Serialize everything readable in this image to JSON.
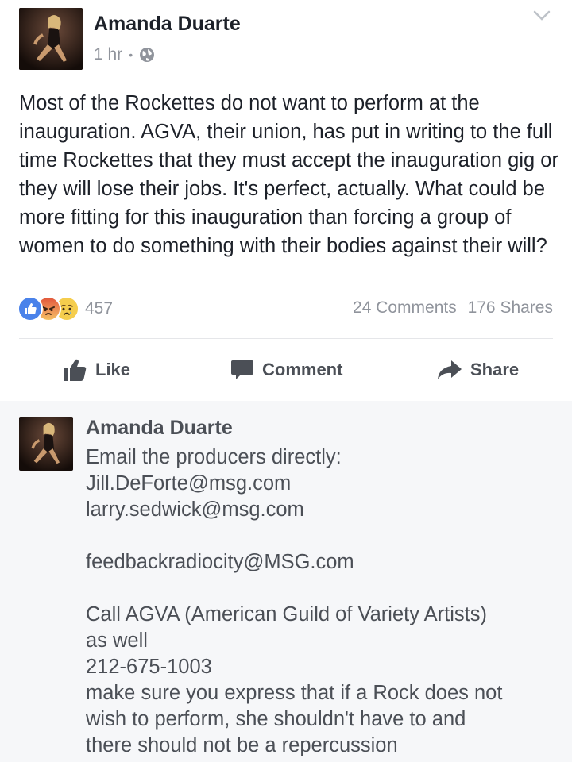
{
  "post": {
    "author": "Amanda Duarte",
    "time": "1 hr",
    "separator": "•",
    "privacy_icon": "globe-icon",
    "text": "Most of the Rockettes do not want to perform at the inauguration. AGVA, their union, has put in writing to the full time Rockettes that they must accept the inauguration gig or they will lose their jobs. It's perfect, actually. What could be more fitting for this inauguration than forcing a group of women to do something with their bodies against their will?",
    "reactions": {
      "icons": [
        "like-reaction-icon",
        "angry-reaction-icon",
        "sad-reaction-icon"
      ],
      "count": "457"
    },
    "comments_count": "24 Comments",
    "shares_count": "176 Shares"
  },
  "actions": {
    "like": "Like",
    "comment": "Comment",
    "share": "Share"
  },
  "comment": {
    "author": "Amanda Duarte",
    "lines": [
      "Email the producers directly:",
      "Jill.DeForte@msg.com",
      "larry.sedwick@msg.com",
      "",
      "feedbackradiocity@MSG.com",
      "",
      "Call AGVA (American Guild of Variety Artists)",
      "as well",
      "212-675-1003",
      "make sure you express that if a Rock does not",
      "wish to perform, she shouldn't have to and",
      "there should not be a repercussion"
    ]
  },
  "colors": {
    "facebook_blue": "#4a82ea",
    "meta_gray": "#90949c",
    "text_dark": "#1d2129",
    "comment_bg": "#f6f7f9"
  }
}
